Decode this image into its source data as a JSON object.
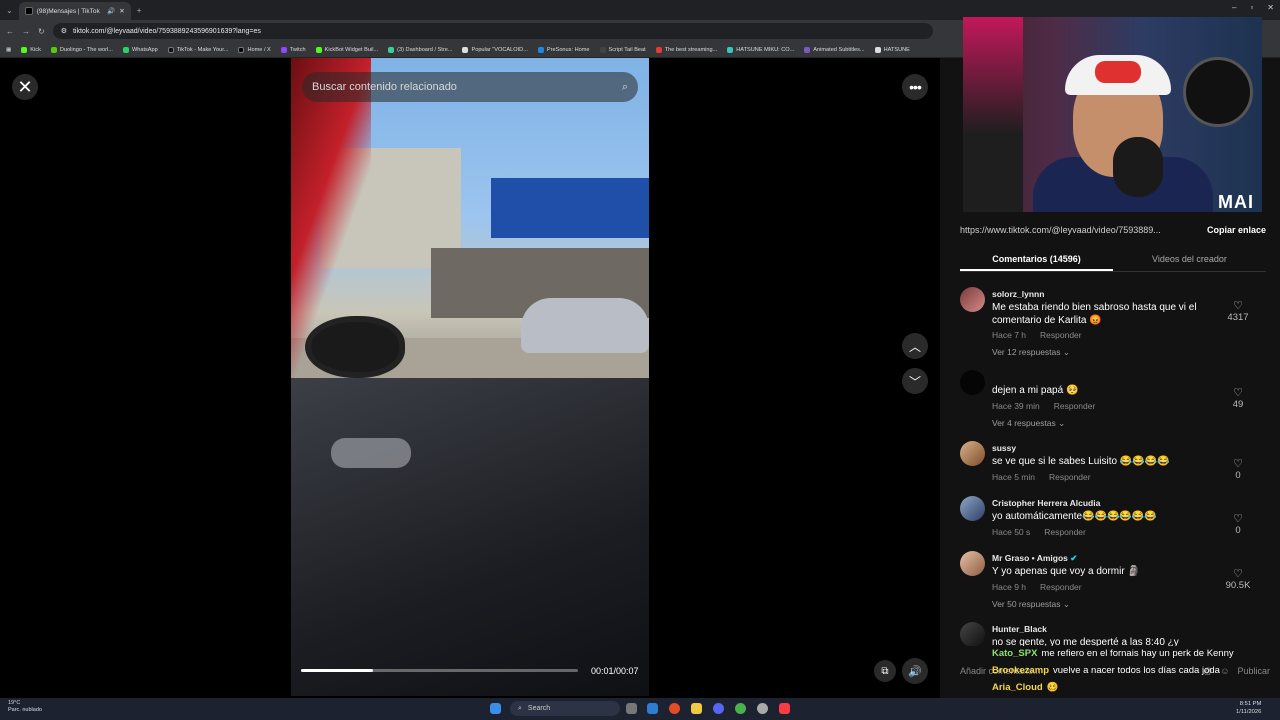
{
  "browser": {
    "tab_title": "(98)Mensajes | TikTok",
    "new_tab": "+",
    "url": "tiktok.com/@leyvaad/video/7593889243596901639?lang=es",
    "bookmarks": [
      "Kick",
      "Duolingo - The worl...",
      "WhatsApp",
      "TikTok - Make Your...",
      "Home / X",
      "Twitch",
      "KickBot Widget Buil...",
      "(3) Dashboard / Stre...",
      "Popular \"VOCALOID...",
      "PreSonus: Home",
      "Script Tail Beat",
      "The best streaming...",
      "HATSUNE MIKU: CO...",
      "Animated Subtitles...",
      "HATSUNE"
    ]
  },
  "video": {
    "search_placeholder": "Buscar contenido relacionado",
    "time": "00:01/00:07",
    "progress": 0.26
  },
  "panel": {
    "webcam_logo": "MAI",
    "link_url": "https://www.tiktok.com/@leyvaad/video/7593889...",
    "copy_label": "Copiar enlace",
    "tab_comments": "Comentarios (14596)",
    "tab_creator": "Videos del creador",
    "comments": [
      {
        "user": "solorz_lynnn",
        "text": "Me estaba riendo bien sabroso hasta que vi el comentario de Karlita 😡",
        "time": "Hace 7 h",
        "reply": "Responder",
        "likes": "4317",
        "replies": "Ver 12 respuestas"
      },
      {
        "user": "",
        "text": "dejen a mi papá 🥺",
        "time": "Hace 39 min",
        "reply": "Responder",
        "likes": "49",
        "replies": "Ver 4 respuestas"
      },
      {
        "user": "sussy",
        "text": "se ve que si le sabes Luisito 😂😂😂😂",
        "time": "Hace 5 min",
        "reply": "Responder",
        "likes": "0",
        "replies": ""
      },
      {
        "user": "Cristopher Herrera Alcudia",
        "text": "yo automáticamente😂😂😂😂😂😂",
        "time": "Hace 50 s",
        "reply": "Responder",
        "likes": "0",
        "replies": ""
      },
      {
        "user": "Mr Graso • Amigos",
        "text": "Y yo apenas que voy a dormir 🗿",
        "time": "Hace 9 h",
        "reply": "Responder",
        "likes": "90.5K",
        "replies": "Ver 50 respuestas"
      },
      {
        "user": "Hunter_Black",
        "text": "no se gente, yo me desperté a las 8:40 ¿y ustedes?",
        "time": "",
        "reply": "",
        "likes": "",
        "replies": ""
      }
    ],
    "add_comment_placeholder": "Añadir comentario...",
    "publish": "Publicar"
  },
  "chat": [
    {
      "name": "Kato_SPX",
      "msg": "me refiero en el fornais hay un perk de Kenny"
    },
    {
      "name": "Brookezamp",
      "msg": "vuelve a nacer todos los días cada joda"
    },
    {
      "name": "Aria_Cloud",
      "msg": "🥴"
    }
  ],
  "taskbar": {
    "weather_temp": "19°C",
    "weather_desc": "Parc. nublado",
    "search": "Search",
    "time": "8:51 PM",
    "date": "1/11/2026"
  },
  "colors": {
    "chat_green": "#8ee06f",
    "chat_yellow": "#f5d64a",
    "panel_bg": "#121212"
  }
}
